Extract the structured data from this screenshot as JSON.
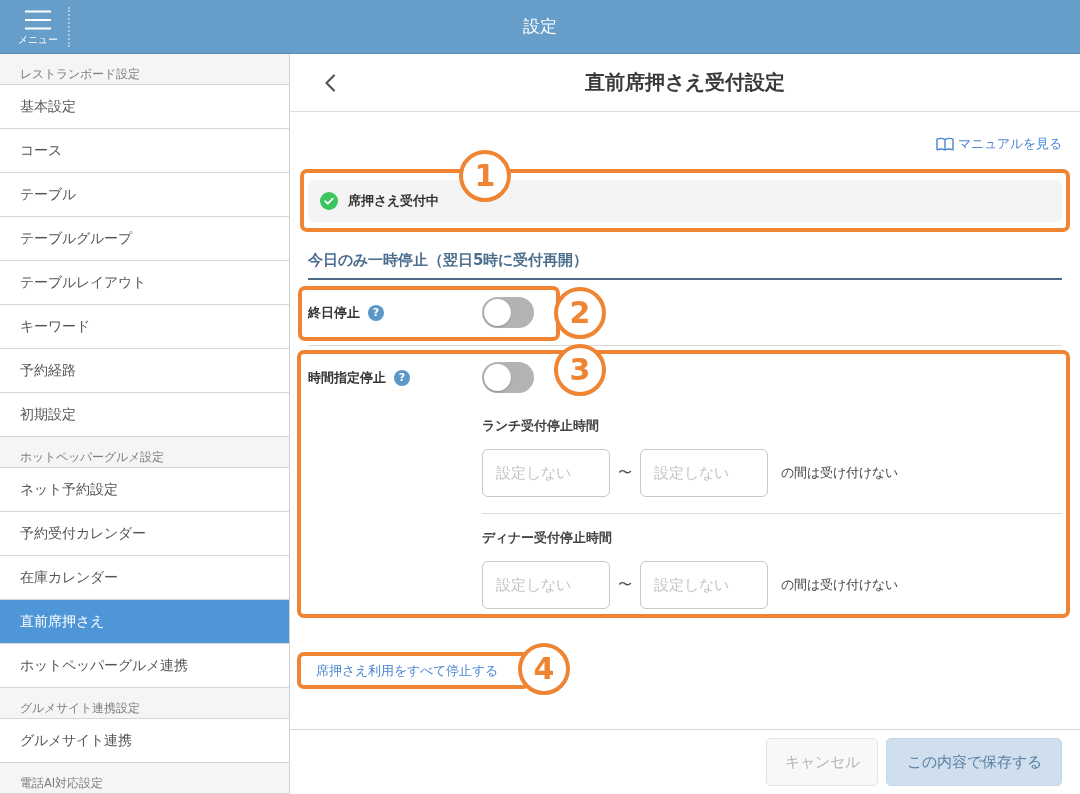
{
  "header": {
    "menu_label": "メニュー",
    "title": "設定"
  },
  "sidebar": {
    "sections": [
      {
        "title": "レストランボード設定",
        "items": [
          {
            "label": "基本設定",
            "selected": false
          },
          {
            "label": "コース",
            "selected": false
          },
          {
            "label": "テーブル",
            "selected": false
          },
          {
            "label": "テーブルグループ",
            "selected": false
          },
          {
            "label": "テーブルレイアウト",
            "selected": false
          },
          {
            "label": "キーワード",
            "selected": false
          },
          {
            "label": "予約経路",
            "selected": false
          },
          {
            "label": "初期設定",
            "selected": false
          }
        ]
      },
      {
        "title": "ホットペッパーグルメ設定",
        "items": [
          {
            "label": "ネット予約設定",
            "selected": false
          },
          {
            "label": "予約受付カレンダー",
            "selected": false
          },
          {
            "label": "在庫カレンダー",
            "selected": false
          },
          {
            "label": "直前席押さえ",
            "selected": true
          },
          {
            "label": "ホットペッパーグルメ連携",
            "selected": false
          }
        ]
      },
      {
        "title": "グルメサイト連携設定",
        "items": [
          {
            "label": "グルメサイト連携",
            "selected": false
          }
        ]
      },
      {
        "title": "電話AI対応設定"
      }
    ]
  },
  "page": {
    "title": "直前席押さえ受付設定"
  },
  "manual_link": "マニュアルを見る",
  "status": {
    "label": "席押さえ受付中",
    "callout": "1"
  },
  "pause_section": {
    "heading": "今日のみ一時停止（翌日5時に受付再開）",
    "all_day": {
      "label": "終日停止",
      "help": "?",
      "on": false,
      "callout": "2"
    },
    "timed": {
      "label": "時間指定停止",
      "help": "?",
      "on": false,
      "callout": "3",
      "ranges": [
        {
          "title": "ランチ受付停止時間",
          "from": {
            "placeholder": "設定しない"
          },
          "separator": "〜",
          "to": {
            "placeholder": "設定しない"
          },
          "suffix": "の間は受け付けない"
        },
        {
          "title": "ディナー受付停止時間",
          "from": {
            "placeholder": "設定しない"
          },
          "separator": "〜",
          "to": {
            "placeholder": "設定しない"
          },
          "suffix": "の間は受け付けない"
        }
      ]
    }
  },
  "stop_all_link": {
    "label": "席押さえ利用をすべて停止する",
    "callout": "4"
  },
  "footer": {
    "buttons": [
      {
        "label": "キャンセル",
        "kind": "secondary",
        "disabled": true
      },
      {
        "label": "この内容で保存する",
        "kind": "primary",
        "disabled": true
      }
    ]
  }
}
